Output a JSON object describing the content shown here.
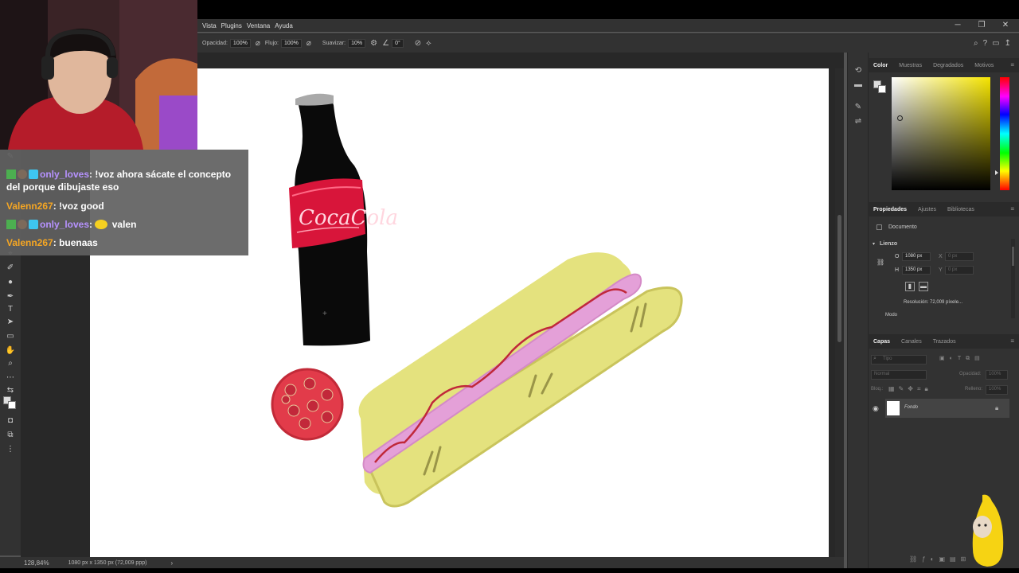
{
  "menu": {
    "items": [
      "Vista",
      "Plugins",
      "Ventana",
      "Ayuda"
    ]
  },
  "options_bar": {
    "opacity_label": "Opacidad:",
    "opacity_value": "100%",
    "flow_label": "Flujo:",
    "flow_value": "100%",
    "smooth_label": "Suavizar:",
    "smooth_value": "10%",
    "angle_value": "0°"
  },
  "status": {
    "zoom": "128,84%",
    "doc_info": "1080 px x 1350 px (72,009 ppp)"
  },
  "color_panel": {
    "tabs": [
      "Color",
      "Muestras",
      "Degradados",
      "Motivos"
    ],
    "active_tab": "Color"
  },
  "properties_panel": {
    "tabs": [
      "Propiedades",
      "Ajustes",
      "Bibliotecas"
    ],
    "doc_label": "Documento",
    "section": "Lienzo",
    "width_label": "O",
    "width_value": "1080 px",
    "x_label": "X",
    "x_value": "0 px",
    "height_label": "H",
    "height_value": "1350 px",
    "y_label": "Y",
    "y_value": "0 px",
    "resolution": "Resolución: 72,009 píxele...",
    "mode_label": "Modo"
  },
  "layers_panel": {
    "tabs": [
      "Capas",
      "Canales",
      "Trazados"
    ],
    "filter_placeholder": "Tipo",
    "blend_mode": "Normal",
    "opacity_label": "Opacidad:",
    "opacity_value": "100%",
    "lock_label": "Bloq.:",
    "fill_label": "Relleno:",
    "fill_value": "100%",
    "layers": [
      {
        "name": "Fondo",
        "visible": true,
        "locked": true
      }
    ]
  },
  "chat": {
    "messages": [
      {
        "user": "only_loves",
        "text": "!voz ahora sácate el concepto del porque dibujaste eso"
      },
      {
        "user": "Valenn267",
        "text": "!voz good"
      },
      {
        "user": "only_loves",
        "text": "valen"
      },
      {
        "user": "Valenn267",
        "text": "buenaas"
      }
    ]
  },
  "drawing": {
    "bottle_label": "CocaCola"
  },
  "colors": {
    "panel_bg": "#323232",
    "canvas_bg": "#ffffff",
    "bun": "#e4e27e",
    "sausage": "#e4a0d8",
    "ketchup": "#c0283a",
    "bottle": "#0a0a0a",
    "label_red": "#d8153a",
    "tomato": "#e23b4a",
    "chat_user1": "#b692ff",
    "chat_user2": "#f5a623"
  }
}
